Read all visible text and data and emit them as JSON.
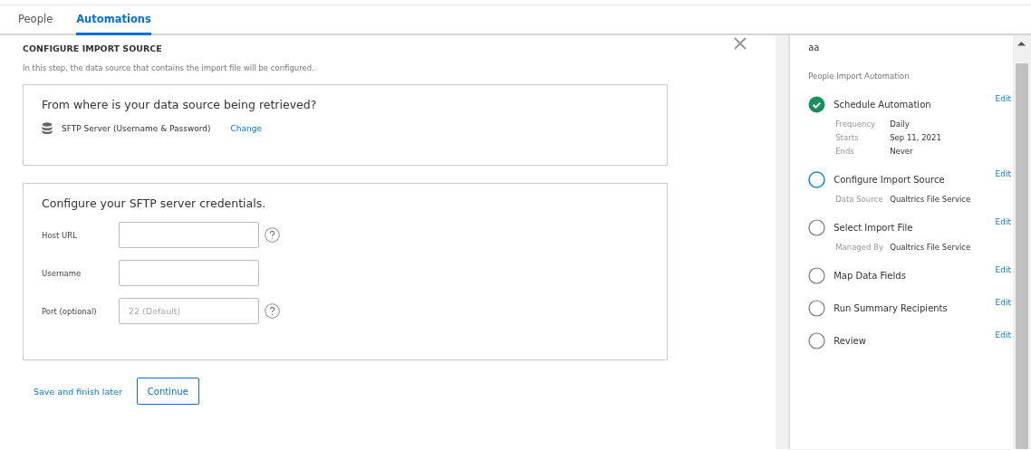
{
  "tabs": [
    {
      "label": "People",
      "selected": false
    },
    {
      "label": "Automations",
      "selected": true
    }
  ],
  "main": {
    "heading": "CONFIGURE IMPORT SOURCE",
    "description": "In this step, the data source that contains the import file will be configured.",
    "source_card": {
      "question": "From where is your data source being retrieved?",
      "source": "SFTP Server (Username & Password)",
      "change_link": "Change"
    },
    "credentials_card": {
      "title": "Configure your SFTP server credentials.",
      "fields": [
        {
          "label": "Host URL",
          "help": true
        },
        {
          "label": "Username",
          "help": false
        },
        {
          "label": "Port (optional)",
          "placeholder": "22 (Default)",
          "help": true
        }
      ]
    },
    "save_link": "Save and finish later",
    "continue_button": "Continue"
  },
  "panel": {
    "name": "aa",
    "subtitle": "People Import Automation",
    "steps": [
      {
        "title": "Schedule Automation",
        "kind": "complete",
        "edit": "Edit",
        "details": [
          {
            "label": "Frequency",
            "value": "Daily"
          },
          {
            "label": "Starts",
            "value": "Sep 11, 2021"
          },
          {
            "label": "Ends",
            "value": "Never"
          }
        ]
      },
      {
        "title": "Configure Import Source",
        "kind": "current",
        "edit": "Edit",
        "details": [
          {
            "label": "Data Source",
            "value": "Qualtrics File Service"
          }
        ]
      },
      {
        "title": "Select Import File",
        "kind": "pending",
        "edit": "Edit",
        "details": [
          {
            "label": "Managed By",
            "value": "Qualtrics File Service"
          }
        ]
      },
      {
        "title": "Map Data Fields",
        "kind": "pending",
        "edit": "Edit"
      },
      {
        "title": "Run Summary Recipients",
        "kind": "pending",
        "edit": "Edit"
      },
      {
        "title": "Review",
        "kind": "pending",
        "edit": "Edit"
      }
    ]
  }
}
